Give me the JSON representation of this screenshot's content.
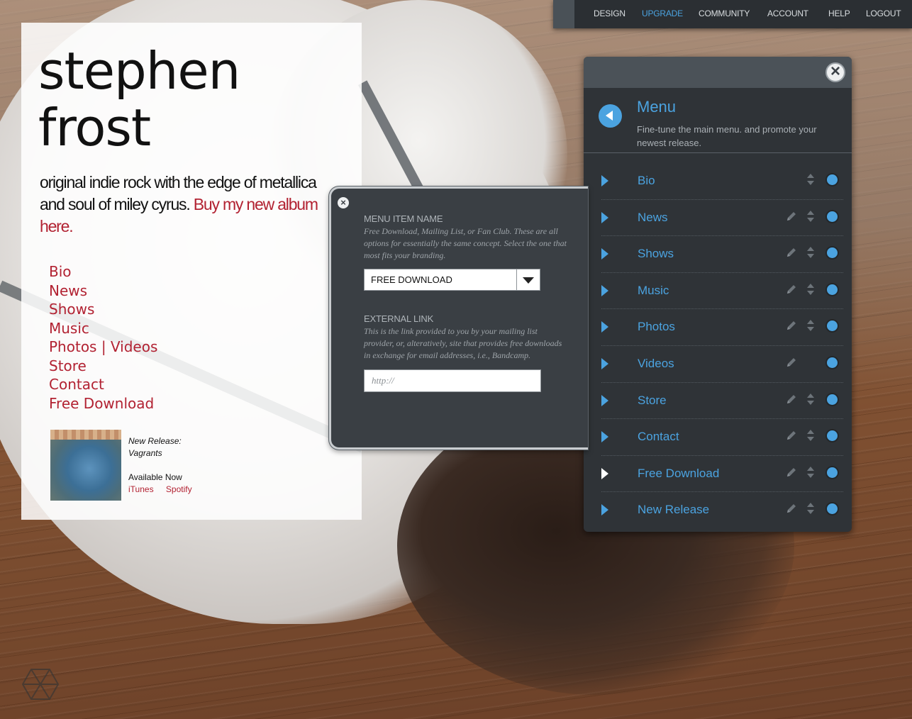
{
  "site": {
    "artist_line1": "stephen",
    "artist_line2": "frost",
    "tagline": "original indie rock with the edge of metallica and soul of miley cyrus.",
    "buy_link": "Buy my new album here.",
    "nav": [
      "Bio",
      "News",
      "Shows",
      "Music",
      "Photos | Videos",
      "Store",
      "Contact",
      "Free Download"
    ],
    "release": {
      "label": "New Release:",
      "title": "Vagrants",
      "available": "Available Now",
      "links": [
        "iTunes",
        "Spotify"
      ]
    }
  },
  "topbar": {
    "items": [
      "DESIGN",
      "UPGRADE",
      "COMMUNITY",
      "ACCOUNT",
      "HELP",
      "LOGOUT"
    ],
    "active": "UPGRADE"
  },
  "panel": {
    "title": "Menu",
    "subtitle": "Fine-tune the main menu. and promote your newest release.",
    "items": [
      {
        "label": "Bio",
        "editable": false,
        "sortable": true
      },
      {
        "label": "News",
        "editable": true,
        "sortable": true
      },
      {
        "label": "Shows",
        "editable": true,
        "sortable": true
      },
      {
        "label": "Music",
        "editable": true,
        "sortable": true
      },
      {
        "label": "Photos",
        "editable": true,
        "sortable": true
      },
      {
        "label": "Videos",
        "editable": true,
        "sortable": false
      },
      {
        "label": "Store",
        "editable": true,
        "sortable": true
      },
      {
        "label": "Contact",
        "editable": true,
        "sortable": true
      },
      {
        "label": "Free Download",
        "editable": true,
        "sortable": true
      },
      {
        "label": "New Release",
        "editable": true,
        "sortable": true
      }
    ],
    "current": "Free Download"
  },
  "popup": {
    "name_label": "MENU ITEM NAME",
    "name_desc": "Free Download, Mailing List, or Fan Club. These are all options for essentially the same  concept. Select the  one that most fits your branding.",
    "name_value": "FREE DOWNLOAD",
    "link_label": "EXTERNAL LINK",
    "link_desc": "This is the link provided to you by your mailing list provider, or, alteratively, site that provides free downloads in exchange for email addresses, i.e., Bandcamp.",
    "link_placeholder": "http://"
  },
  "colors": {
    "accent_red": "#b22232",
    "accent_blue": "#4ba3e0",
    "panel_bg": "#2f3337"
  }
}
